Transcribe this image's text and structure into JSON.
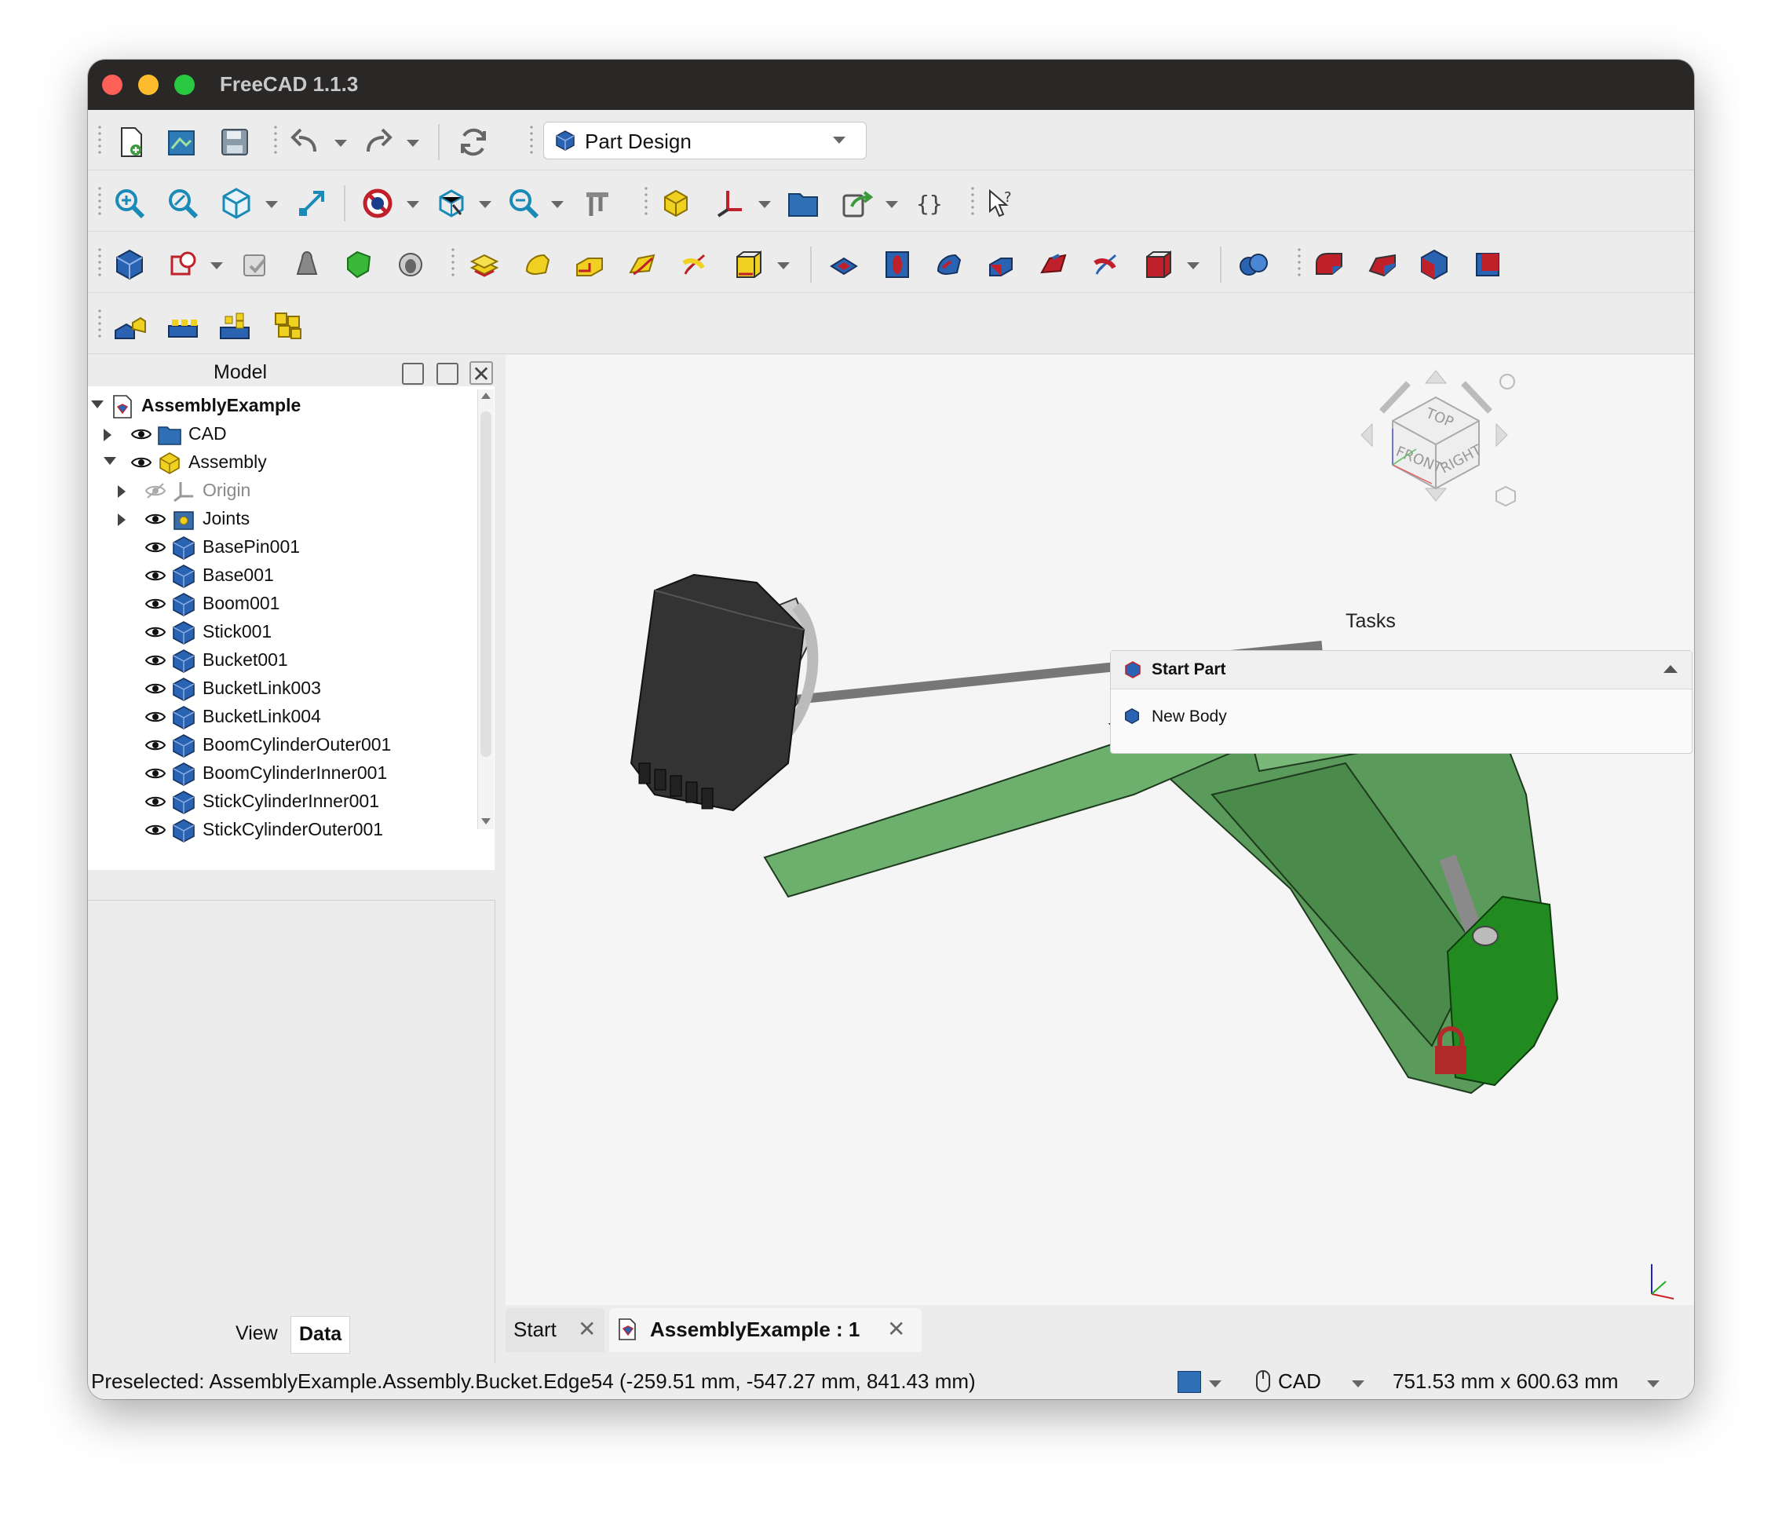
{
  "window": {
    "title": "FreeCAD 1.1.3",
    "traffic_colors": {
      "close": "#fe5f57",
      "minimize": "#febc2e",
      "zoom": "#28c840"
    }
  },
  "toolbar": {
    "workbench": "Part Design"
  },
  "model_panel": {
    "title": "Model",
    "tree": [
      {
        "label": "AssemblyExample",
        "icon": "document-icon",
        "level": 0,
        "expanded": true,
        "bold": true
      },
      {
        "label": "CAD",
        "icon": "folder-icon",
        "level": 1,
        "expanded": false,
        "eye": true
      },
      {
        "label": "Assembly",
        "icon": "assembly-icon",
        "level": 1,
        "expanded": true,
        "eye": true
      },
      {
        "label": "Origin",
        "icon": "origin-icon",
        "level": 2,
        "expanded": false,
        "eye": "hidden"
      },
      {
        "label": "Joints",
        "icon": "joints-icon",
        "level": 2,
        "expanded": false,
        "eye": true
      },
      {
        "label": "BasePin001",
        "icon": "body-icon",
        "level": 2,
        "eye": true
      },
      {
        "label": "Base001",
        "icon": "body-icon",
        "level": 2,
        "eye": true
      },
      {
        "label": "Boom001",
        "icon": "body-icon",
        "level": 2,
        "eye": true
      },
      {
        "label": "Stick001",
        "icon": "body-icon",
        "level": 2,
        "eye": true
      },
      {
        "label": "Bucket001",
        "icon": "body-icon",
        "level": 2,
        "eye": true
      },
      {
        "label": "BucketLink003",
        "icon": "body-icon",
        "level": 2,
        "eye": true
      },
      {
        "label": "BucketLink004",
        "icon": "body-icon",
        "level": 2,
        "eye": true
      },
      {
        "label": "BoomCylinderOuter001",
        "icon": "body-icon",
        "level": 2,
        "eye": true
      },
      {
        "label": "BoomCylinderInner001",
        "icon": "body-icon",
        "level": 2,
        "eye": true
      },
      {
        "label": "StickCylinderInner001",
        "icon": "body-icon",
        "level": 2,
        "eye": true
      },
      {
        "label": "StickCylinderOuter001",
        "icon": "body-icon",
        "level": 2,
        "eye": true
      }
    ],
    "tabs": {
      "view": "View",
      "data": "Data"
    }
  },
  "navcube": {
    "top": "TOP",
    "front": "FRONT",
    "right": "RIGHT"
  },
  "tasks": {
    "title": "Tasks",
    "section": "Start Part",
    "items": [
      "New Body"
    ]
  },
  "doc_tabs": {
    "start": "Start",
    "active": "AssemblyExample : 1"
  },
  "statusbar": {
    "message": "Preselected: AssemblyExample.Assembly.Bucket.Edge54 (-259.51 mm, -547.27 mm, 841.43 mm)",
    "nav_style": "CAD",
    "dimensions": "751.53 mm x 600.63 mm"
  },
  "colors": {
    "green_part": "#5a9a5a",
    "dark_green": "#218a21",
    "bucket": "#333333",
    "selection_red": "#b02a2a"
  }
}
